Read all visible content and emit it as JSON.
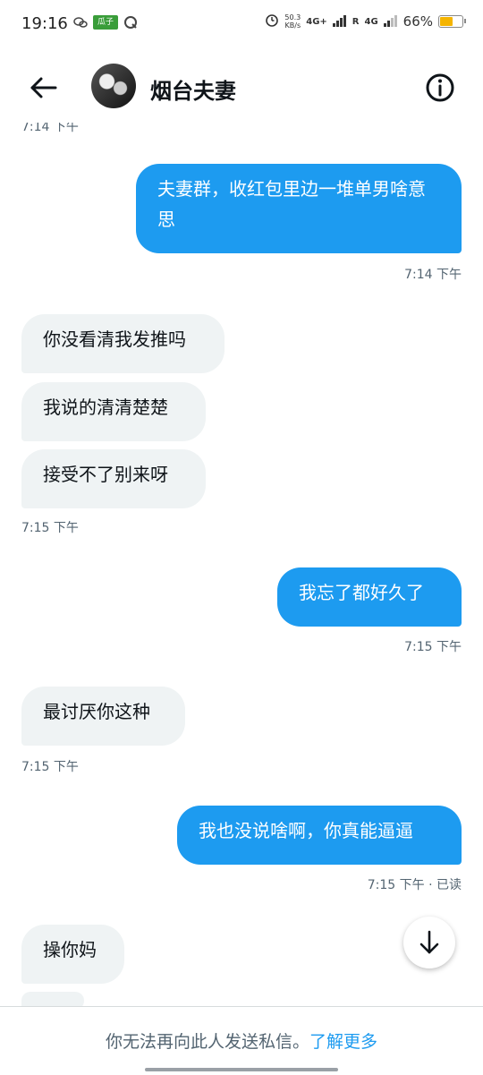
{
  "status_bar": {
    "time": "19:16",
    "app_icon_text": "瓜子",
    "net_speed_value": "50.3",
    "net_speed_unit": "KB/s",
    "signal_1": "4G+",
    "roaming": "R",
    "signal_2": "4G",
    "battery_percent": "66%"
  },
  "header": {
    "title": "烟台夫妻",
    "icons": [
      "back-arrow-icon",
      "info-icon"
    ]
  },
  "messages": [
    {
      "direction": "outgoing",
      "text": "夫妻群，收红包里边一堆单男啥意思",
      "time": "7:14 下午"
    },
    {
      "direction": "incoming",
      "text": "你没看清我发推吗"
    },
    {
      "direction": "incoming",
      "text": "我说的清清楚楚"
    },
    {
      "direction": "incoming",
      "text": "接受不了别来呀",
      "time": "7:15 下午"
    },
    {
      "direction": "outgoing",
      "text": "我忘了都好久了",
      "time": "7:15 下午"
    },
    {
      "direction": "incoming",
      "text": "最讨厌你这种",
      "time": "7:15 下午"
    },
    {
      "direction": "outgoing",
      "text": "我也没说啥啊，你真能逼逼",
      "time": "7:15 下午 · 已读"
    },
    {
      "direction": "incoming",
      "text": "操你妈"
    }
  ],
  "footer": {
    "notice": "你无法再向此人发送私信。",
    "link": "了解更多"
  },
  "colors": {
    "accent": "#1d9bf0",
    "incoming_bubble": "#eff3f4",
    "meta_text": "#536471"
  }
}
